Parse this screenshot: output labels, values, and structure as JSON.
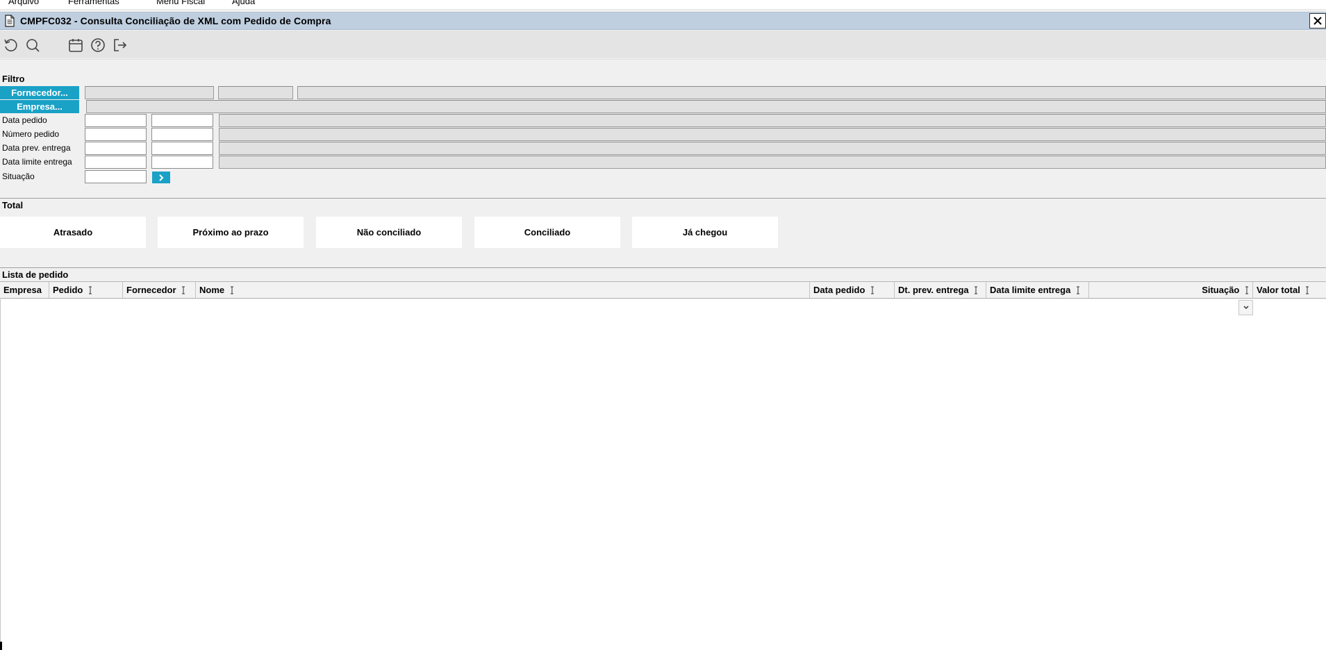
{
  "menu": [
    {
      "label": "Arquivo"
    },
    {
      "label": "Ferramentas"
    },
    {
      "label": "Menu Fiscal"
    },
    {
      "label": "Ajuda"
    }
  ],
  "window": {
    "title": "CMPFC032 - Consulta Conciliação de XML com Pedido de Compra"
  },
  "toolbar": [
    {
      "icon": "refresh-icon"
    },
    {
      "icon": "search-icon"
    },
    {
      "icon": "calendar-icon"
    },
    {
      "icon": "help-icon"
    },
    {
      "icon": "exit-icon"
    }
  ],
  "filtro": {
    "label": "Filtro",
    "fornecedor_button": "Fornecedor...",
    "empresa_button": "Empresa...",
    "fields": [
      {
        "label": "Data pedido",
        "from": "",
        "to": ""
      },
      {
        "label": "Número pedido",
        "from": "",
        "to": ""
      },
      {
        "label": "Data prev. entrega",
        "from": "",
        "to": ""
      },
      {
        "label": "Data limite entrega",
        "from": "",
        "to": ""
      }
    ],
    "situacao": {
      "label": "Situação",
      "value": ""
    }
  },
  "total": {
    "label": "Total",
    "cards": [
      {
        "label": "Atrasado"
      },
      {
        "label": "Próximo ao prazo"
      },
      {
        "label": "Não conciliado"
      },
      {
        "label": "Conciliado"
      },
      {
        "label": "Já chegou"
      }
    ]
  },
  "lista": {
    "label": "Lista de pedido",
    "columns": [
      {
        "label": "Empresa",
        "align": "left"
      },
      {
        "label": "Pedido",
        "align": "left"
      },
      {
        "label": "Fornecedor",
        "align": "left"
      },
      {
        "label": "Nome",
        "align": "left"
      },
      {
        "label": "Data pedido",
        "align": "left"
      },
      {
        "label": "Dt. prev. entrega",
        "align": "left"
      },
      {
        "label": "Data limite entrega",
        "align": "left"
      },
      {
        "label": "Situação",
        "align": "right"
      },
      {
        "label": "Valor total",
        "align": "left"
      }
    ],
    "rows": []
  },
  "colors": {
    "accent": "#1aa1c6",
    "titlebar": "#bfcfe0",
    "toolbar": "#e4e4e4",
    "background": "#f0f0f0"
  }
}
